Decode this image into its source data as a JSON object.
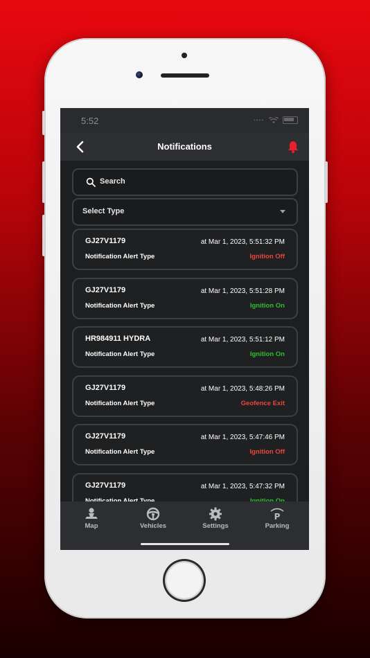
{
  "status_bar": {
    "time": "5:52"
  },
  "header": {
    "title": "Notifications"
  },
  "search": {
    "placeholder": "Search"
  },
  "filter": {
    "selected": "Select Type"
  },
  "notifications": [
    {
      "vehicle": "GJ27V1179",
      "timestamp": "at Mar 1, 2023, 5:51:32 PM",
      "label": "Notification Alert Type",
      "status": "Ignition Off",
      "status_color": "#e8463c"
    },
    {
      "vehicle": "GJ27V1179",
      "timestamp": "at Mar 1, 2023, 5:51:28 PM",
      "label": "Notification Alert Type",
      "status": "Ignition On",
      "status_color": "#2fbf2f"
    },
    {
      "vehicle": "HR984911 HYDRA",
      "timestamp": "at Mar 1, 2023, 5:51:12 PM",
      "label": "Notification Alert Type",
      "status": "Ignition On",
      "status_color": "#2fbf2f"
    },
    {
      "vehicle": "GJ27V1179",
      "timestamp": "at Mar 1, 2023, 5:48:26 PM",
      "label": "Notification Alert Type",
      "status": "Geofence Exit",
      "status_color": "#e8463c"
    },
    {
      "vehicle": "GJ27V1179",
      "timestamp": "at Mar 1, 2023, 5:47:46 PM",
      "label": "Notification Alert Type",
      "status": "Ignition Off",
      "status_color": "#e8463c"
    },
    {
      "vehicle": "GJ27V1179",
      "timestamp": "at Mar 1, 2023, 5:47:32 PM",
      "label": "Notification Alert Type",
      "status": "Ignition On",
      "status_color": "#2fbf2f"
    }
  ],
  "tabs": [
    {
      "label": "Map",
      "icon": "map-pin-person-icon"
    },
    {
      "label": "Vehicles",
      "icon": "steering-wheel-icon"
    },
    {
      "label": "Settings",
      "icon": "gear-icon"
    },
    {
      "label": "Parking",
      "icon": "parking-icon"
    }
  ],
  "colors": {
    "accent": "#e8202a",
    "status_red": "#e8463c",
    "status_green": "#2fbf2f"
  }
}
